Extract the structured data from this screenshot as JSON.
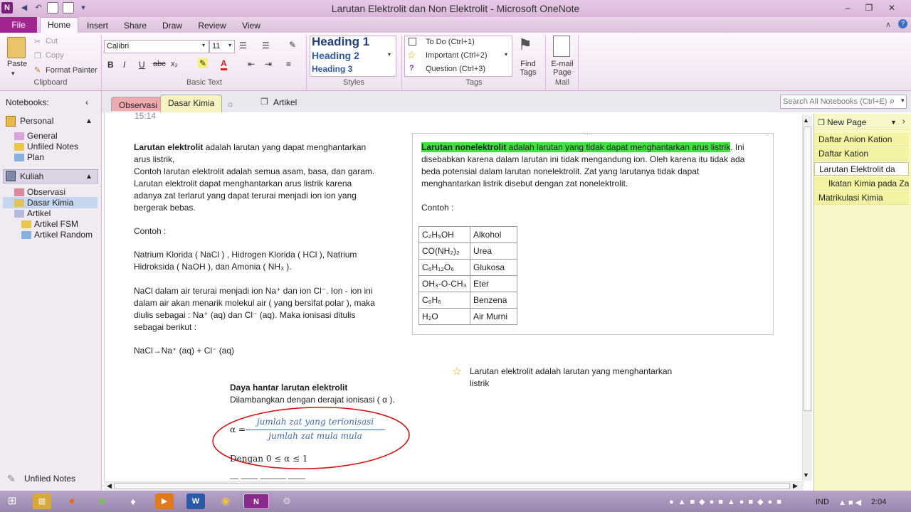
{
  "window": {
    "title": "Larutan Elektrolit dan Non Elektrolit  -  Microsoft OneNote"
  },
  "ribbon": {
    "tabs": [
      "File",
      "Home",
      "Insert",
      "Share",
      "Draw",
      "Review",
      "View"
    ],
    "clipboard": {
      "paste": "Paste",
      "cut": "Cut",
      "copy": "Copy",
      "format_painter": "Format Painter",
      "label": "Clipboard"
    },
    "basic_text": {
      "font": "Calibri",
      "size": "11",
      "label": "Basic Text"
    },
    "styles": {
      "h1": "Heading 1",
      "h2": "Heading 2",
      "h3": "Heading 3",
      "label": "Styles"
    },
    "tags": {
      "todo": "To Do (Ctrl+1)",
      "important": "Important (Ctrl+2)",
      "question": "Question (Ctrl+3)",
      "label": "Tags"
    },
    "find_tags": "Find Tags",
    "email": "E-mail Page",
    "mail_label": "Mail"
  },
  "nav": {
    "header": "Notebooks:",
    "notebooks": [
      {
        "name": "Personal",
        "sections": [
          "General",
          "Unfiled Notes",
          "Plan"
        ]
      },
      {
        "name": "Kuliah",
        "sections": [
          "Observasi",
          "Dasar Kimia",
          "Artikel",
          "Artikel FSM",
          "Artikel Random"
        ]
      }
    ],
    "footer": "Unfiled Notes"
  },
  "section_tabs": [
    "Observasi",
    "Dasar Kimia",
    "Artikel"
  ],
  "search": {
    "placeholder": "Search All Notebooks (Ctrl+E)"
  },
  "page": {
    "time": "15:14",
    "left": {
      "p1_bold": "Larutan elektrolit",
      "p1_rest": " adalah larutan yang dapat menghantarkan",
      "p1_line2": "arus listrik,",
      "p2": "Contoh larutan elektrolit adalah semua asam, basa, dan garam.",
      "p3": "Larutan elektrolit dapat menghantarkan arus listrik karena",
      "p4": "adanya zat terlarut yang dapat terurai menjadi ion ion yang",
      "p5": "bergerak bebas.",
      "contoh": " Contoh :",
      "ex1": " Natrium Klorida ( NaCl ) , Hidrogen Klorida ( HCl ), Natrium",
      "ex2": "Hidroksida ( NaOH ), dan Amonia ( NH₃ ).",
      "n1": "NaCl dalam air terurai menjadi ion Na⁺ dan ion Cl⁻. Ion - ion ini",
      "n2": "dalam air akan menarik molekul air ( yang bersifat polar ), maka",
      "n3": "diulis sebagai : Na⁺ (aq) dan Cl⁻ (aq). Maka ionisasi ditulis",
      "n4": "sebagai berikut :",
      "eq": " NaCl→Na⁺ (aq) + Cl⁻ (aq)"
    },
    "right": {
      "h_bold": "Larutan nonelektrolit",
      "h_rest": " adalah larutan yang tidak dapat menghantarkan arus listrik",
      "h_end": ". Ini",
      "r2": "disebabkan karena dalam larutan ini tidak mengandung ion. Oleh karena itu tidak ada",
      "r3": "beda potensial dalam larutan nonelektrolit. Zat yang larutanya tidak dapat",
      "r4": "menghantarkan listrik disebut dengan zat nonelektrolit.",
      "contoh": "Contoh :",
      "table": [
        [
          "C₂H₅OH",
          "Alkohol"
        ],
        [
          "CO(NH₂)₂",
          "Urea"
        ],
        [
          "C₆H₁₂O₆",
          "Glukosa"
        ],
        [
          "OH₃-O-CH₃",
          "Eter"
        ],
        [
          "C₆H₆",
          "Benzena"
        ],
        [
          "H₂O",
          "Air Murni"
        ]
      ]
    },
    "star_note": {
      "l1": "Larutan elektrolit adalah larutan yang menghantarkan",
      "l2": "listrik"
    },
    "daya": {
      "title": "Daya hantar larutan elektrolit",
      "sub": "Dilambangkan dengan derajat ionisasi ( α ).",
      "alpha": "α =",
      "num": "jumlah zat yang terionisasi",
      "den": "jumlah zat mula mula",
      "range": "Dengan 0 ≤ α ≤ 1"
    }
  },
  "pages": [
    "New Page",
    "Daftar Anion Kation",
    "Daftar Kation",
    "Larutan Elektrolit da",
    "Ikatan Kimia pada Za",
    "Matrikulasi Kimia"
  ],
  "taskbar": {
    "lang": "IND",
    "time": "2:04"
  },
  "colors": {
    "accent": "#a3258f",
    "highlight": "#3fe03f",
    "page_list": "#f7f7c8"
  }
}
